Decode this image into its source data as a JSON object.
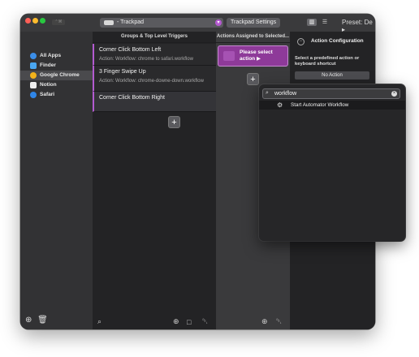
{
  "toolbar": {
    "trigger_type": "- Trackpad",
    "trackpad_settings": "Trackpad Settings",
    "preset": "Preset: De ▸",
    "badge": "⌃⌘"
  },
  "sidebar": {
    "items": [
      {
        "label": "All Apps",
        "icon": "globe-icon",
        "color": "#3b8ee8"
      },
      {
        "label": "Finder",
        "icon": "finder-icon",
        "color": "#4aa6f0"
      },
      {
        "label": "Google Chrome",
        "icon": "chrome-icon",
        "color": "#f2b21b"
      },
      {
        "label": "Notion",
        "icon": "notion-icon",
        "color": "#eeeeee"
      },
      {
        "label": "Safari",
        "icon": "safari-icon",
        "color": "#2f86e8"
      }
    ],
    "selected_index": 2
  },
  "triggers": {
    "header": "Groups & Top Level Triggers",
    "items": [
      {
        "title": "Corner Click Bottom Left",
        "subtitle": "Action: Workflow: chrome to safari.workflow"
      },
      {
        "title": "3 Finger Swipe Up",
        "subtitle": "Action: Workflow: chrome-downe-down.workflow"
      },
      {
        "title": "Corner Click Bottom Right",
        "subtitle": ""
      }
    ]
  },
  "actions": {
    "header": "Actions Assigned to Selected...",
    "card_label": "Please select action ▶"
  },
  "config": {
    "title": "Action Configuration",
    "description": "Select a predefined action or keyboard shortcut",
    "no_action": "No Action"
  },
  "popup": {
    "search_value": "workflow",
    "results": [
      "Start Automator Workflow"
    ]
  },
  "accent_color": "#b35bd0"
}
